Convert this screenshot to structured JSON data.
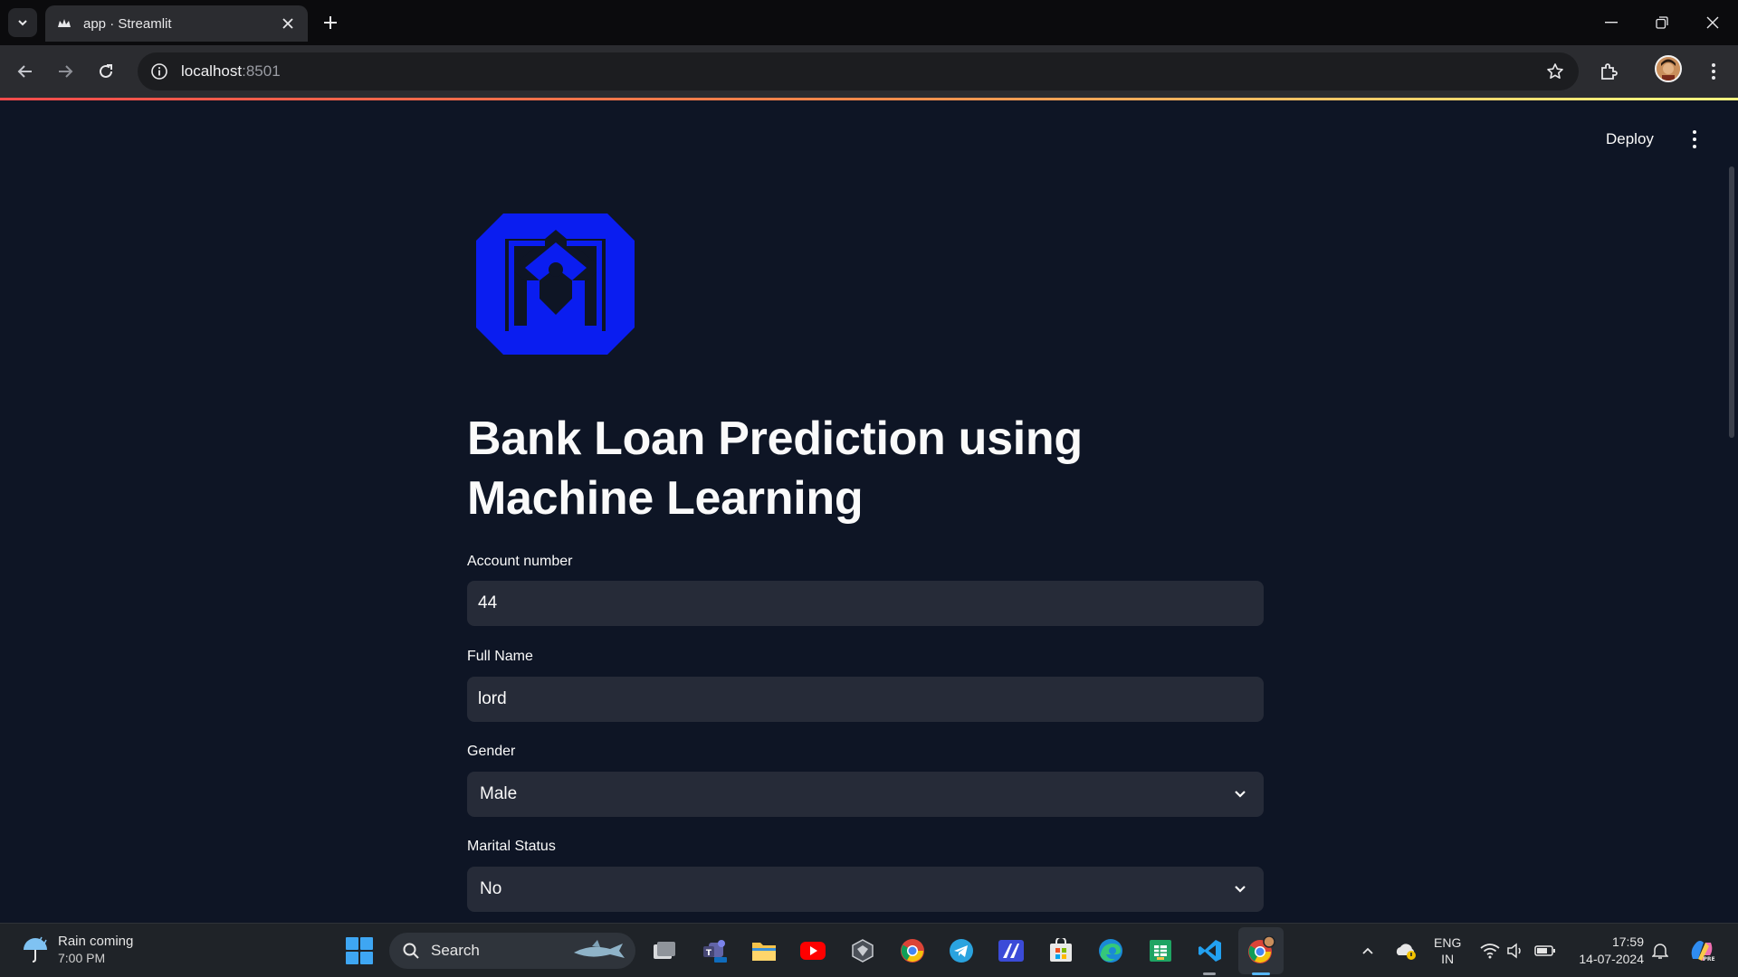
{
  "browser": {
    "tab_title": "app · Streamlit",
    "url_host": "localhost",
    "url_port": ":8501"
  },
  "header": {
    "deploy_label": "Deploy"
  },
  "main": {
    "title": "Bank Loan Prediction using Machine Learning",
    "fields": [
      {
        "label": "Account number",
        "value": "44",
        "type": "text"
      },
      {
        "label": "Full Name",
        "value": "lord",
        "type": "text"
      },
      {
        "label": "Gender",
        "value": "Male",
        "type": "select"
      },
      {
        "label": "Marital Status",
        "value": "No",
        "type": "select"
      }
    ]
  },
  "taskbar": {
    "weather_title": "Rain coming",
    "weather_time": "7:00 PM",
    "search_label": "Search",
    "lang_top": "ENG",
    "lang_bottom": "IN",
    "time": "17:59",
    "date": "14-07-2024",
    "apps": [
      "task-view-icon",
      "teams-icon",
      "file-explorer-icon",
      "youtube-icon",
      "app-icon",
      "chrome-icon",
      "telegram-icon",
      "editor-icon",
      "store-icon",
      "edge-icon",
      "sheets-icon",
      "vscode-icon",
      "chrome-profile-icon"
    ]
  },
  "colors": {
    "page_bg": "#0e1525",
    "input_bg": "#262b38",
    "logo_blue": "#0a1df0",
    "accent_gradient_start": "#ff4b4b",
    "accent_gradient_end": "#fffd80"
  }
}
